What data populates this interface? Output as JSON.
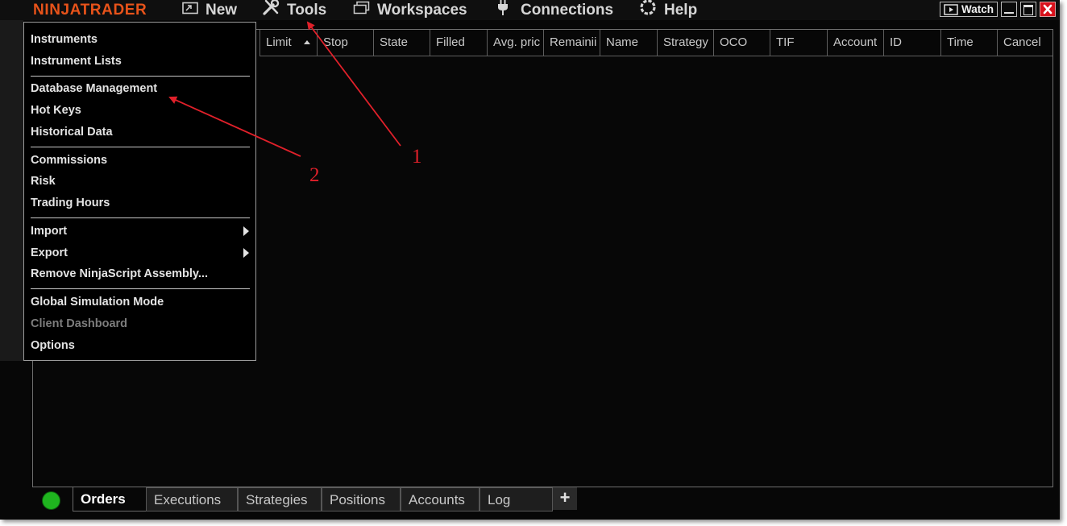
{
  "titlebar": {
    "brand": "NINJATRADER",
    "menu": [
      {
        "label": "New",
        "icon": "new-window-icon"
      },
      {
        "label": "Tools",
        "icon": "wrench-screwdriver-icon"
      },
      {
        "label": "Workspaces",
        "icon": "workspaces-icon"
      },
      {
        "label": "Connections",
        "icon": "plug-icon"
      },
      {
        "label": "Help",
        "icon": "lifebuoy-icon"
      }
    ],
    "watch_label": "Watch"
  },
  "columns": [
    "Limit",
    "Stop",
    "State",
    "Filled",
    "Avg. pric",
    "Remainii",
    "Name",
    "Strategy",
    "OCO",
    "TIF",
    "Account",
    "ID",
    "Time",
    "Cancel"
  ],
  "tools_menu": {
    "items": [
      {
        "label": "Instruments"
      },
      {
        "label": "Instrument Lists"
      },
      {
        "label": "Database Management"
      },
      {
        "label": "Hot Keys"
      },
      {
        "label": "Historical Data"
      },
      {
        "label": "Commissions"
      },
      {
        "label": "Risk"
      },
      {
        "label": "Trading Hours"
      },
      {
        "label": "Import",
        "submenu": true
      },
      {
        "label": "Export",
        "submenu": true
      },
      {
        "label": "Remove NinjaScript Assembly..."
      },
      {
        "label": "Global Simulation Mode"
      },
      {
        "label": "Client Dashboard",
        "disabled": true
      },
      {
        "label": "Options"
      }
    ]
  },
  "bottom_tabs": [
    "Orders",
    "Executions",
    "Strategies",
    "Positions",
    "Accounts",
    "Log"
  ],
  "active_tab": "Orders",
  "annotations": [
    "1",
    "2"
  ],
  "colors": {
    "brand": "#e8531a",
    "annotation": "#e0202a",
    "status_connected": "#1fb51f",
    "background": "#070707"
  }
}
